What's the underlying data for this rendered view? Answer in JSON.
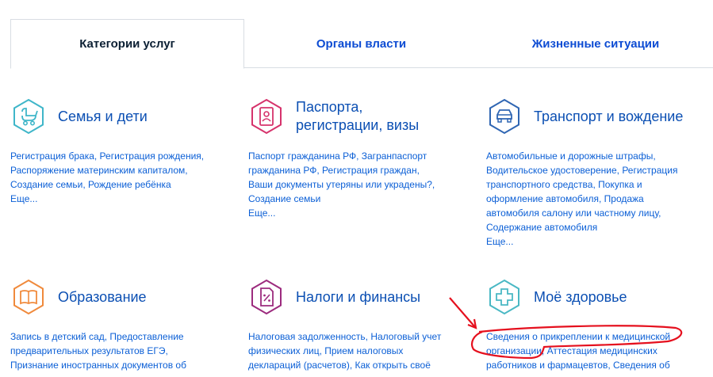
{
  "tabs": [
    {
      "label": "Категории услуг",
      "active": true
    },
    {
      "label": "Органы власти",
      "active": false
    },
    {
      "label": "Жизненные ситуации",
      "active": false
    }
  ],
  "categories": [
    {
      "title": "Семья и дети",
      "icon": "baby-carriage-icon",
      "color": "#3fb6c9",
      "lines": [
        "Регистрация брака, Регистрация рождения,",
        "Распоряжение материнским капиталом,",
        "Создание семьи, Рождение ребёнка"
      ],
      "more": "Еще..."
    },
    {
      "title": "Паспорта, регистрации, визы",
      "title_lines": [
        "Паспорта,",
        "регистрации, визы"
      ],
      "icon": "passport-icon",
      "color": "#d6336c",
      "lines": [
        "Паспорт гражданина РФ, Загранпаспорт",
        "гражданина РФ, Регистрация граждан,",
        "Ваши документы утеряны или украдены?,",
        "Создание семьи"
      ],
      "more": "Еще..."
    },
    {
      "title": "Транспорт и вождение",
      "icon": "car-icon",
      "color": "#2f66b3",
      "lines": [
        "Автомобильные и дорожные штрафы,",
        "Водительское удостоверение, Регистрация",
        "транспортного средства, Покупка и",
        "оформление автомобиля, Продажа",
        "автомобиля салону или частному лицу,",
        "Содержание автомобиля"
      ],
      "more": "Еще..."
    },
    {
      "title": "Образование",
      "icon": "book-icon",
      "color": "#f08a3c",
      "lines": [
        "Запись в детский сад, Предоставление",
        "предварительных результатов ЕГЭ,",
        "Признание иностранных документов об"
      ],
      "more": ""
    },
    {
      "title": "Налоги и финансы",
      "icon": "tax-document-icon",
      "color": "#9c2b7e",
      "lines": [
        "Налоговая задолженность, Налоговый учет",
        "физических лиц, Прием налоговых",
        "деклараций (расчетов), Как открыть своё"
      ],
      "more": ""
    },
    {
      "title": "Моё здоровье",
      "icon": "medical-cross-icon",
      "color": "#4ab8c4",
      "lines": [
        "Сведения о прикреплении к медицинской",
        "организации, Аттестация медицинских",
        "работников и фармацевтов, Сведения об"
      ],
      "more": ""
    }
  ],
  "annotation": {
    "color": "#e5101e"
  }
}
